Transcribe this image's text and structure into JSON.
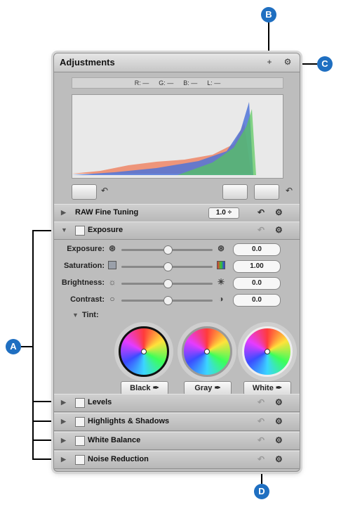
{
  "panel": {
    "title": "Adjustments",
    "add_icon": "+",
    "gear_icon": "⚙"
  },
  "readout": {
    "r": "R: —",
    "g": "G: —",
    "b": "B: —",
    "l": "L: —"
  },
  "histogram": {
    "undo": "↶",
    "undo2": "↶"
  },
  "raw": {
    "label": "RAW Fine Tuning",
    "value": "1.0 ÷"
  },
  "exposure_section": {
    "label": "Exposure"
  },
  "sliders": [
    {
      "label": "Exposure:",
      "value": "0.0",
      "pos": 0.5
    },
    {
      "label": "Saturation:",
      "value": "1.00",
      "pos": 0.5
    },
    {
      "label": "Brightness:",
      "value": "0.0",
      "pos": 0.5
    },
    {
      "label": "Contrast:",
      "value": "0.0",
      "pos": 0.5
    }
  ],
  "tint": {
    "label": "Tint:"
  },
  "wheels": {
    "black": "Black",
    "gray": "Gray",
    "white": "White"
  },
  "sections": [
    {
      "label": "Levels"
    },
    {
      "label": "Highlights & Shadows"
    },
    {
      "label": "White Balance"
    },
    {
      "label": "Noise Reduction"
    }
  ],
  "callouts": {
    "a": "A",
    "b": "B",
    "c": "C",
    "d": "D"
  },
  "colors": {
    "callout": "#1f6fc1"
  }
}
